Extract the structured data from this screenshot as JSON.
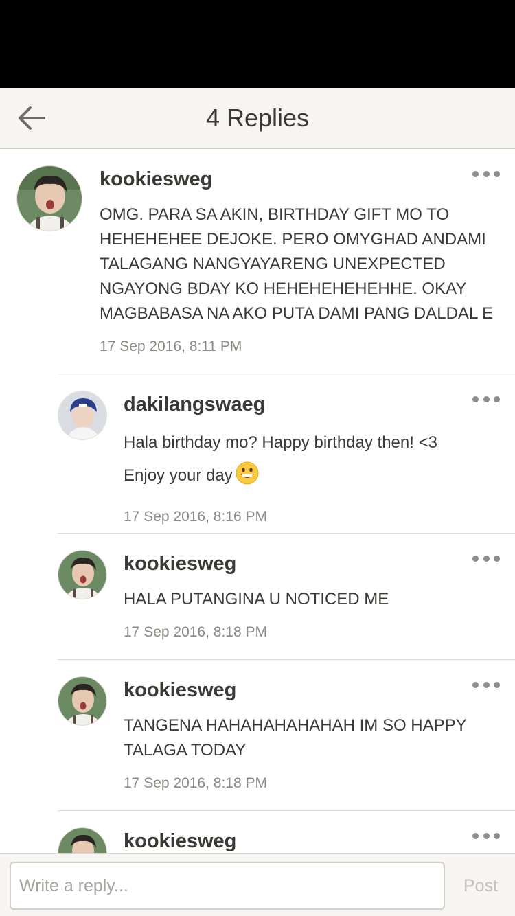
{
  "header": {
    "title": "4 Replies",
    "back_icon": "arrow-left-icon"
  },
  "main_comment": {
    "username": "kookiesweg",
    "lines": [
      "OMG. PARA SA AKIN, BIRTHDAY GIFT MO TO",
      "HEHEHEHEE DEJOKE. PERO OMYGHAD ANDAMI",
      "TALAGANG NANGYAYARENG UNEXPECTED",
      "NGAYONG BDAY KO HEHEHEHEHEHHE. OKAY",
      "MAGBABASA NA AKO PUTA DAMI PANG DALDAL E"
    ],
    "timestamp": "17 Sep 2016, 8:11 PM"
  },
  "replies": [
    {
      "username": "dakilangswaeg",
      "lines": [
        "Hala birthday mo? Happy birthday then! <3",
        "Enjoy your day"
      ],
      "emoji": "grinning-face-emoji",
      "timestamp": "17 Sep 2016, 8:16 PM"
    },
    {
      "username": "kookiesweg",
      "lines": [
        "HALA PUTANGINA U NOTICED ME"
      ],
      "timestamp": "17 Sep 2016, 8:18 PM"
    },
    {
      "username": "kookiesweg",
      "lines": [
        "TANGENA HAHAHAHAHAHAH IM SO HAPPY",
        "TALAGA TODAY"
      ],
      "timestamp": "17 Sep 2016, 8:18 PM"
    },
    {
      "username": "kookiesweg"
    }
  ],
  "composer": {
    "placeholder": "Write a reply...",
    "post_label": "Post"
  },
  "colors": {
    "header_bg": "#f6f5f1",
    "text": "#3b3935",
    "muted_text": "#8c8984",
    "post_disabled": "#c4c1bc"
  }
}
